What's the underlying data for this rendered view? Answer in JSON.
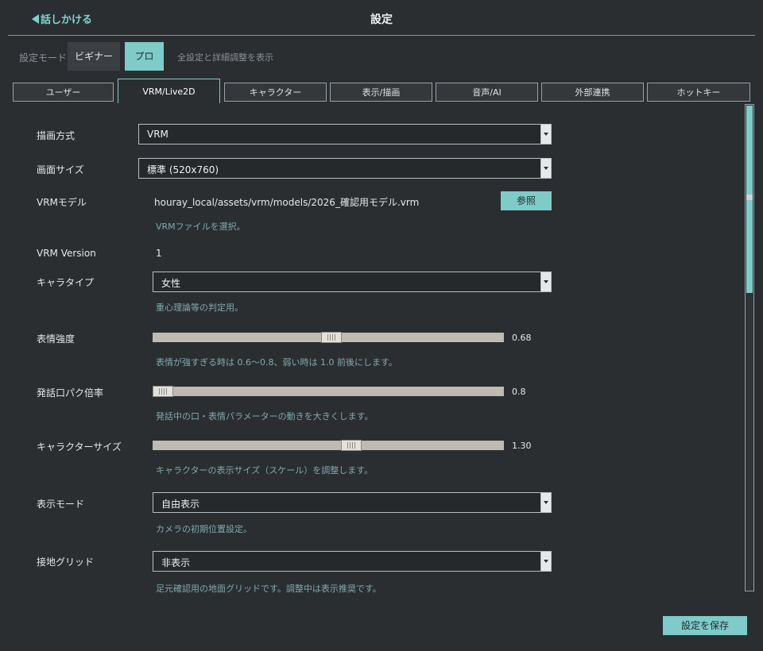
{
  "header": {
    "back_label": "話しかける",
    "title": "設定"
  },
  "mode": {
    "label": "設定モード",
    "beginner": "ビギナー",
    "pro": "プロ",
    "description": "全設定と詳細調整を表示"
  },
  "tabs": [
    {
      "label": "ユーザー"
    },
    {
      "label": "VRM/Live2D"
    },
    {
      "label": "キャラクター"
    },
    {
      "label": "表示/描画"
    },
    {
      "label": "音声/AI"
    },
    {
      "label": "外部連携"
    },
    {
      "label": "ホットキー"
    }
  ],
  "settings": {
    "render_method": {
      "label": "描画方式",
      "value": "VRM"
    },
    "screen_size": {
      "label": "画面サイズ",
      "value": "標準 (520x760)"
    },
    "vrm_model": {
      "label": "VRMモデル",
      "path": "houray_local/assets/vrm/models/2026_確認用モデル.vrm",
      "browse": "参照",
      "hint": "VRMファイルを選択。"
    },
    "vrm_version": {
      "label": "VRM Version",
      "value": "1"
    },
    "chara_type": {
      "label": "キャラタイプ",
      "value": "女性",
      "hint": "重心理論等の判定用。"
    },
    "expression_strength": {
      "label": "表情強度",
      "value": "0.68",
      "ratio": 0.51,
      "hint": "表情が強すぎる時は 0.6〜0.8、弱い時は 1.0 前後にします。"
    },
    "lip_sync": {
      "label": "発話口パク倍率",
      "value": "0.8",
      "ratio": 0.0,
      "hint": "発話中の口・表情パラメーターの動きを大きくします。"
    },
    "character_size": {
      "label": "キャラクターサイズ",
      "value": "1.30",
      "ratio": 0.57,
      "hint": "キャラクターの表示サイズ（スケール）を調整します。"
    },
    "display_mode": {
      "label": "表示モード",
      "value": "自由表示",
      "hint": "カメラの初期位置設定。"
    },
    "ground_grid": {
      "label": "接地グリッド",
      "value": "非表示",
      "hint": "足元確認用の地面グリッドです。調整中は表示推奨です。"
    }
  },
  "footer": {
    "save_label": "設定を保存"
  },
  "colors": {
    "accent": "#7ecbc9",
    "background": "#2b2e31",
    "hint": "#7fa9ae"
  }
}
